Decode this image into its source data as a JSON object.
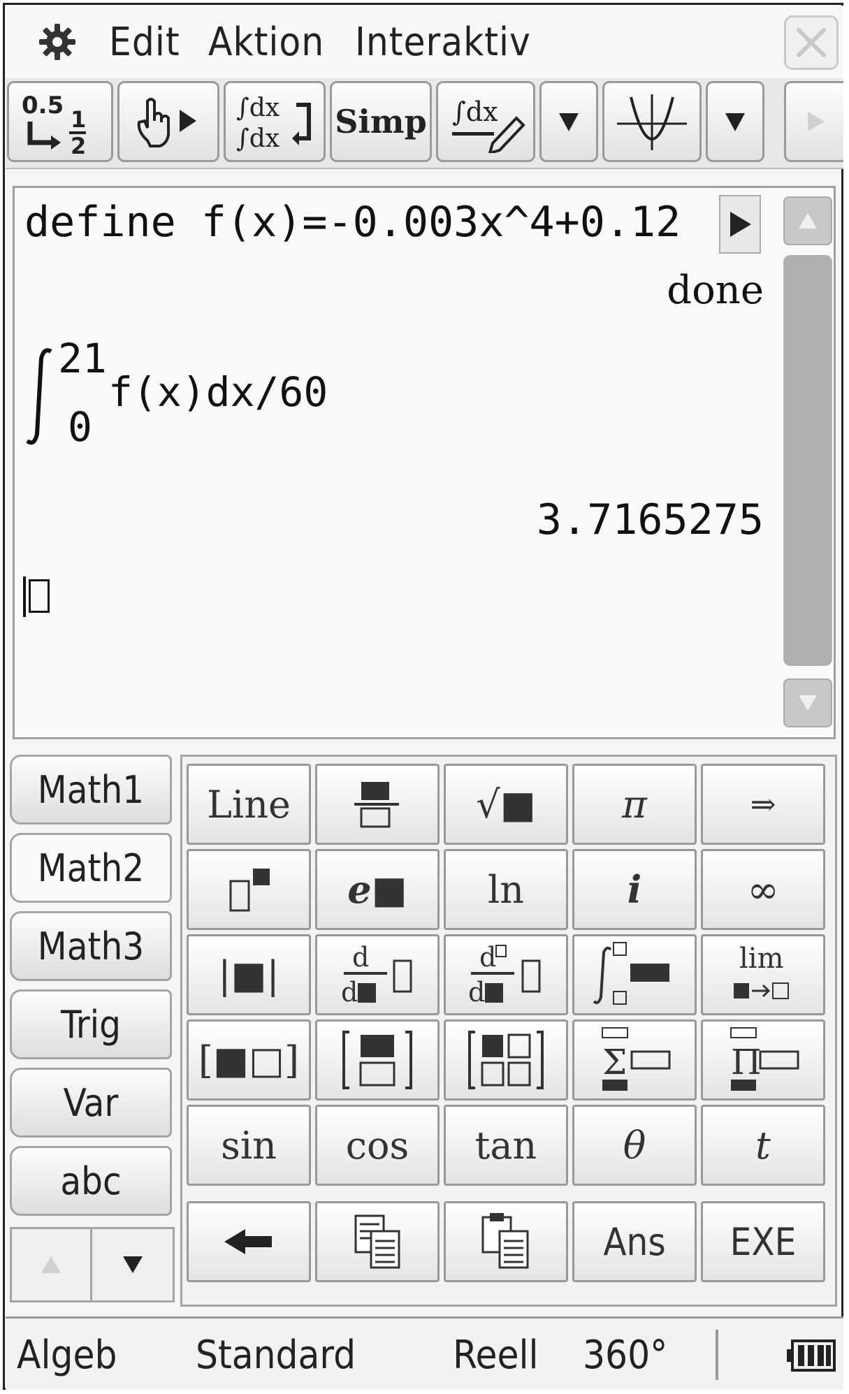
{
  "menu": {
    "items": [
      "Edit",
      "Aktion",
      "Interaktiv"
    ]
  },
  "toolbar": {
    "buttons": [
      {
        "name": "decimal-fraction-toggle",
        "icon": "decimal-fraction-icon",
        "top": "0.5",
        "bottom": "1/2"
      },
      {
        "name": "hand-drag",
        "icon": "hand-pointer-icon"
      },
      {
        "name": "integral-edit",
        "icon": "integral-stack-icon",
        "label": "∫dx ∫dx"
      },
      {
        "name": "simp",
        "label": "Simp"
      },
      {
        "name": "integral-pen",
        "icon": "integral-pen-icon",
        "label": "∫dx"
      },
      {
        "name": "dropdown-1",
        "icon": "triangle-down-icon"
      },
      {
        "name": "graph",
        "icon": "graph-parabola-icon"
      },
      {
        "name": "dropdown-2",
        "icon": "triangle-down-icon"
      },
      {
        "name": "more",
        "icon": "triangle-right-icon"
      }
    ]
  },
  "work": {
    "line1": "define f(x)=-0.003x^4+0.12",
    "result1": "done",
    "integral_upper": "21",
    "integral_lower": "0",
    "integral_body": "f(x)dx/60",
    "result2": "3.7165275"
  },
  "tabs": [
    "Math1",
    "Math2",
    "Math3",
    "Trig",
    "Var",
    "abc"
  ],
  "keys": {
    "row1": [
      "Line",
      "fraction-icon",
      "√■",
      "π",
      "⇒"
    ],
    "row2": [
      "power-icon",
      "e■",
      "ln",
      "i",
      "∞"
    ],
    "row3": [
      "|■|",
      "d/d■",
      "d²/d■²",
      "integral-template-icon",
      "lim"
    ],
    "row4": [
      "[■□]",
      "matrix-2x1-icon",
      "matrix-2x2-icon",
      "Σ",
      "Π"
    ],
    "row5": [
      "sin",
      "cos",
      "tan",
      "θ",
      "t"
    ],
    "row6": [
      "backspace-icon",
      "copy-icon",
      "paste-icon",
      "Ans",
      "EXE"
    ]
  },
  "status": {
    "mode": "Algeb",
    "format": "Standard",
    "number": "Reell",
    "angle": "360°"
  },
  "colors": {
    "background": "#f4f5f4",
    "scrollbar": "#b0b0b0"
  }
}
